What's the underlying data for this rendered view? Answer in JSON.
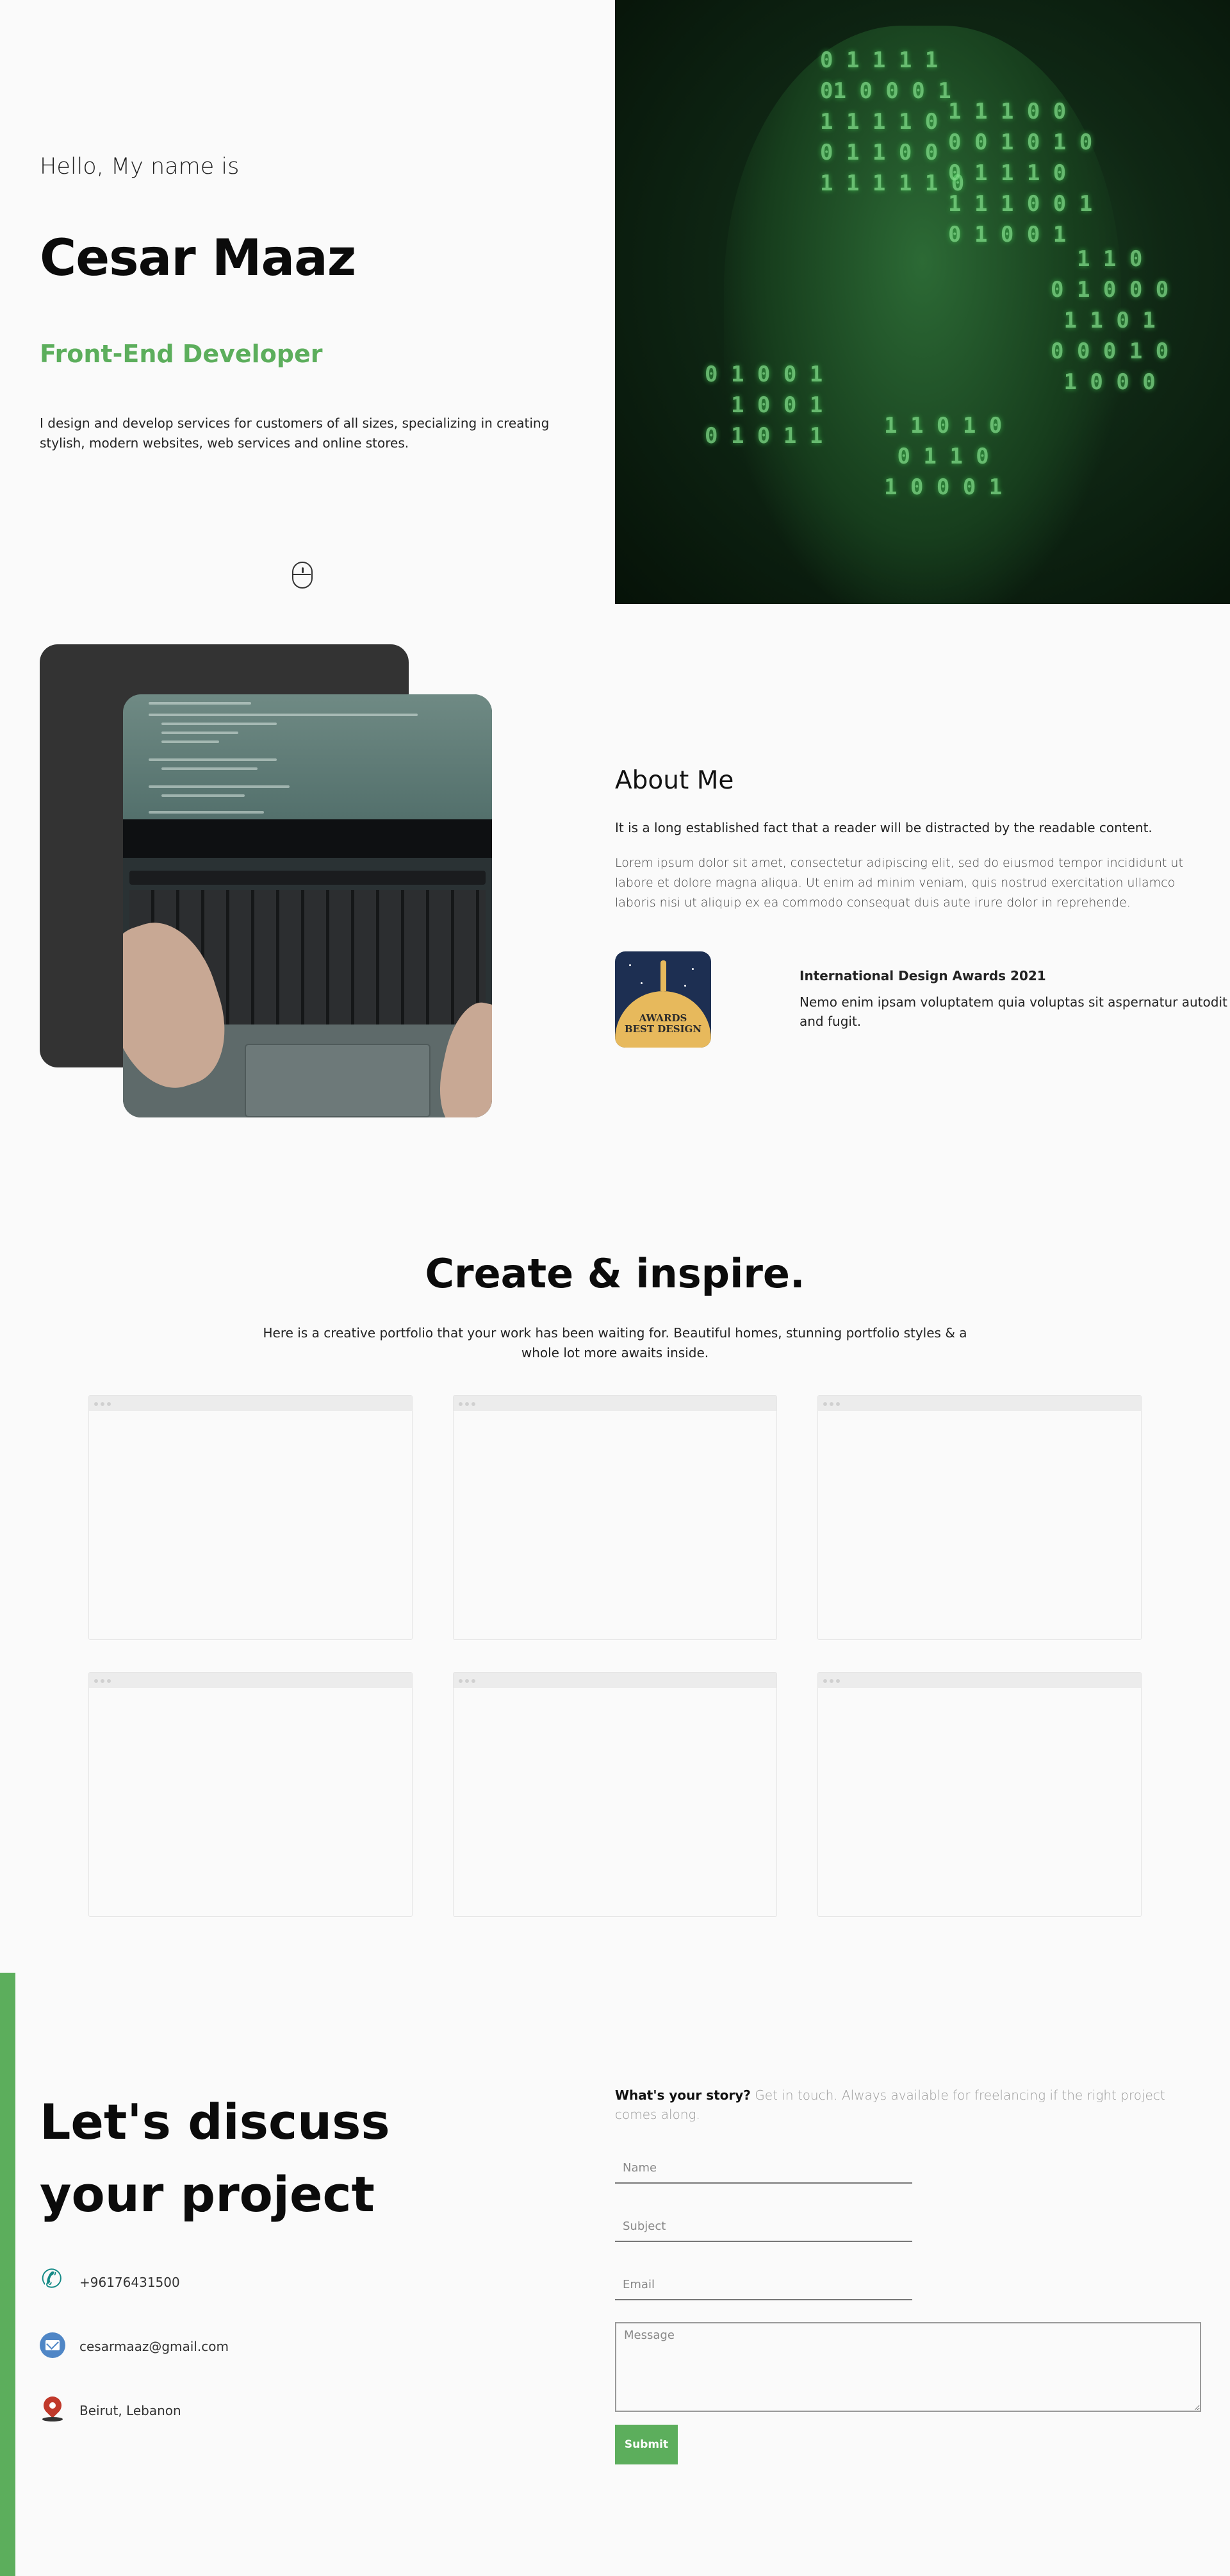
{
  "hero": {
    "greeting": "Hello, My name is",
    "name": "Cesar Maaz",
    "role": "Front-End Developer",
    "intro": "I design and develop services for customers of all sizes, specializing in creating stylish, modern websites, web services and online stores.",
    "scroll_icon": "mouse-icon",
    "image_icon": "binary-code-portrait-image",
    "theme_toggle": "light-dark-toggle"
  },
  "about": {
    "title": "About Me",
    "lead": "It is a long established fact that a reader will be distracted by the readable content.",
    "body": "Lorem ipsum dolor sit amet, consectetur adipiscing elit, sed do eiusmod tempor incididunt ut labore et dolore magna aliqua. Ut enim ad minim veniam, quis nostrud exercitation ullamco laboris nisi ut aliquip ex ea commodo consequat duis aute irure dolor in reprehende.",
    "award": {
      "badge_line1": "AWARDS",
      "badge_line2": "BEST DESIGN",
      "title": "International Design Awards 2021",
      "description": "Nemo enim ipsam voluptatem quia voluptas sit aspernatur autodit and fugit."
    }
  },
  "portfolio": {
    "title": "Create & inspire.",
    "subtitle": "Here is a creative portfolio that your work has been waiting for. Beautiful homes, stunning portfolio styles & a whole lot more awaits inside."
  },
  "contact": {
    "heading": "Let's discuss your project",
    "phone": "+96176431500",
    "email": "cesarmaaz@gmail.com",
    "location": "Beirut, Lebanon",
    "story_bold": "What's your story?",
    "story_text": " Get in touch. Always available for freelancing if the right project comes along.",
    "form": {
      "name_placeholder": "Name",
      "subject_placeholder": "Subject",
      "email_placeholder": "Email",
      "message_placeholder": "Message",
      "submit_label": "Submit"
    }
  },
  "colors": {
    "accent": "#5cae5c",
    "dark_card": "#333333",
    "background": "#fafafa"
  }
}
